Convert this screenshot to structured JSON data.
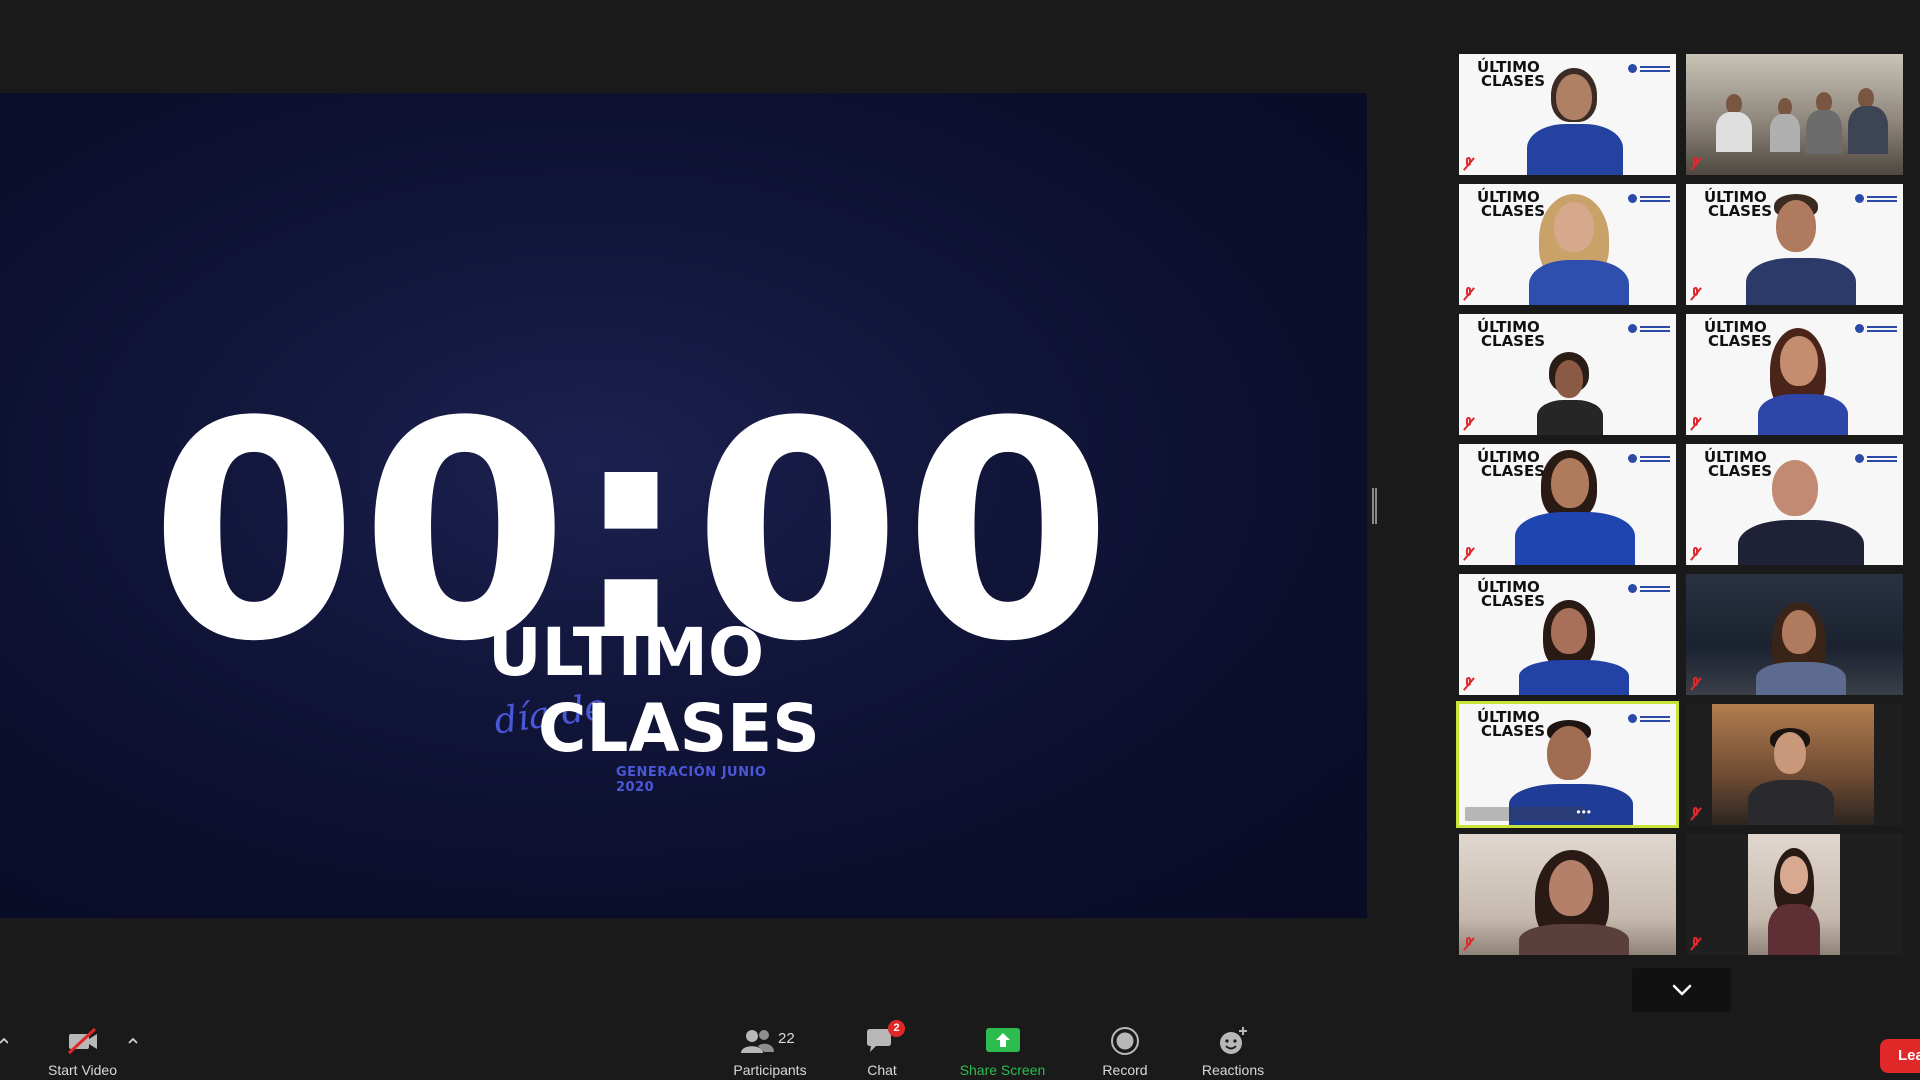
{
  "shared_screen": {
    "countdown": "00:00",
    "logo_line1": "ÚLTIMO",
    "logo_script": "día de",
    "logo_line2": "CLASES",
    "logo_sub": "GENERACIÓN JUNIO 2020"
  },
  "gallery": {
    "tile_logo_line1": "ÚLTIMO",
    "tile_logo_line2": "CLASES",
    "scroll_icon": "chevron-down-icon"
  },
  "toolbar": {
    "start_video": "Start Video",
    "participants_label": "Participants",
    "participants_count": "22",
    "chat_label": "Chat",
    "chat_badge": "2",
    "share_screen_label": "Share Screen",
    "record_label": "Record",
    "reactions_label": "Reactions",
    "leave_label": "Lea"
  },
  "colors": {
    "share_screen_green": "#2dbd4e",
    "leave_red": "#e02828",
    "active_speaker": "#c7e33a",
    "brand_blue": "#4a58d8"
  }
}
